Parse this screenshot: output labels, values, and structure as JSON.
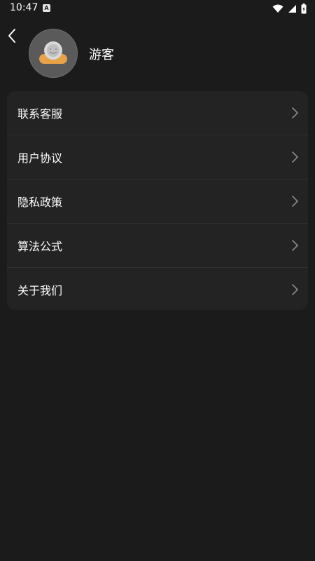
{
  "status_bar": {
    "time": "10:47",
    "notification_icon": "a-badge-icon",
    "icons": [
      "wifi-icon",
      "signal-icon",
      "battery-icon"
    ]
  },
  "header": {
    "back_icon": "chevron-left-icon",
    "avatar_icon": "default-avatar-icon",
    "username": "游客"
  },
  "menu": {
    "items": [
      {
        "label": "联系客服",
        "icon": "chevron-right-icon"
      },
      {
        "label": "用户协议",
        "icon": "chevron-right-icon"
      },
      {
        "label": "隐私政策",
        "icon": "chevron-right-icon"
      },
      {
        "label": "算法公式",
        "icon": "chevron-right-icon"
      },
      {
        "label": "关于我们",
        "icon": "chevron-right-icon"
      }
    ]
  },
  "colors": {
    "background": "#1b1b1b",
    "card": "#232323",
    "text": "#ffffff",
    "chevron": "#8a8a8a",
    "avatar_accent": "#e8a24a"
  }
}
